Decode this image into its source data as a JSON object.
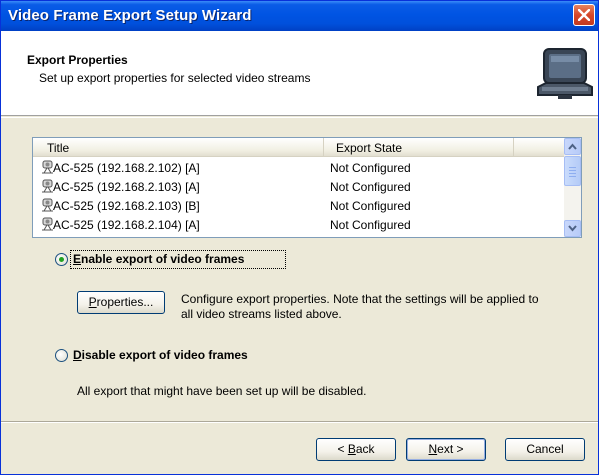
{
  "window": {
    "title": "Video Frame Export Setup Wizard"
  },
  "header": {
    "title": "Export Properties",
    "subtitle": "Set up export properties for selected video streams"
  },
  "list": {
    "columns": [
      "Title",
      "Export State"
    ],
    "rows": [
      {
        "title": "AC-525 (192.168.2.102) [A]",
        "state": "Not Configured"
      },
      {
        "title": "AC-525 (192.168.2.103) [A]",
        "state": "Not Configured"
      },
      {
        "title": "AC-525 (192.168.2.103) [B]",
        "state": "Not Configured"
      },
      {
        "title": "AC-525 (192.168.2.104) [A]",
        "state": "Not Configured"
      }
    ]
  },
  "enable_option": {
    "label_first": "E",
    "label_rest": "nable export of video frames",
    "selected": true
  },
  "properties_button": {
    "label_first": "P",
    "label_rest": "roperties..."
  },
  "properties_desc": {
    "line1": "Configure export properties. Note that the settings will be applied to",
    "line2": "all video streams listed above."
  },
  "disable_option": {
    "label_first": "D",
    "label_rest": "isable export of video frames",
    "selected": false
  },
  "disable_desc": "All export that might have been set up will be disabled.",
  "buttons": {
    "back_prefix": "< ",
    "back_key": "B",
    "back_rest": "ack",
    "next_key": "N",
    "next_rest": "ext >",
    "cancel": "Cancel"
  },
  "colors": {
    "titlebar": "#0054e3",
    "selected_radio": "#21a121",
    "close_button": "#d6472a"
  },
  "icons": [
    "close-icon",
    "wizard-computer-icon",
    "camera-icon",
    "scroll-up-icon",
    "scroll-down-icon"
  ]
}
